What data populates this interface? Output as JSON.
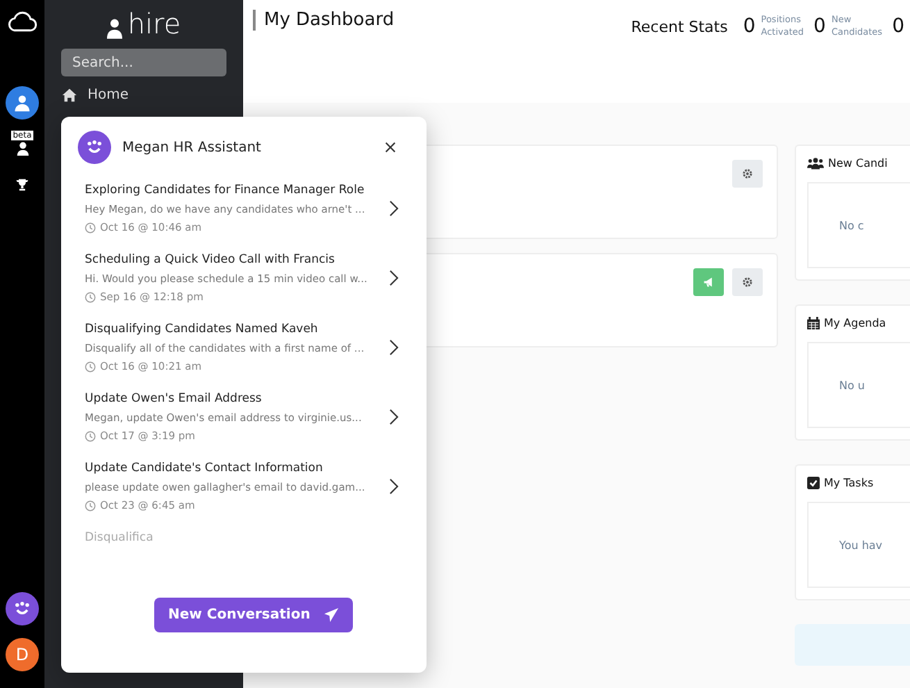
{
  "brand": {
    "name": "hire"
  },
  "sidebar": {
    "search": {
      "placeholder": "Search..."
    },
    "items": [
      {
        "label": "Home",
        "selected": false
      }
    ]
  },
  "rail": {
    "badge": "beta",
    "avatar_letter": "D"
  },
  "header": {
    "title": "My Dashboard",
    "stats_label": "Recent Stats",
    "stats": [
      {
        "value": "0",
        "label_1": "Positions",
        "label_2": "Activated"
      },
      {
        "value": "0",
        "label_1": "New",
        "label_2": "Candidates"
      },
      {
        "value": "0"
      }
    ]
  },
  "positions": [
    {
      "promote": false
    },
    {
      "promote": true
    }
  ],
  "widgets": [
    {
      "kind": "candidates",
      "title": "New Candi",
      "message": "No c"
    },
    {
      "kind": "agenda",
      "title": "My Agenda",
      "message": "No u"
    },
    {
      "kind": "tasks",
      "title": "My Tasks",
      "message": "You hav"
    }
  ],
  "assistant": {
    "title": "Megan HR Assistant",
    "conversations": [
      {
        "title": "Exploring Candidates for Finance Manager Role",
        "preview": "Hey Megan, do we have any candidates who arne't ...",
        "time": "Oct 16 @ 10:46 am"
      },
      {
        "title": "Scheduling a Quick Video Call with Francis",
        "preview": "Hi. Would you please schedule a 15 min video call w...",
        "time": "Sep 16 @ 12:18 pm"
      },
      {
        "title": "Disqualifying Candidates Named Kaveh",
        "preview": "Disqualify all of the candidates with a first name of ...",
        "time": "Oct 16 @ 10:21 am"
      },
      {
        "title": "Update Owen's Email Address",
        "preview": "Megan, update Owen's email address to virginie.us...",
        "time": "Oct 17 @ 3:19 pm"
      },
      {
        "title": "Update Candidate's Contact Information",
        "preview": "please update owen gallagher's email to david.gam...",
        "time": "Oct 23 @ 6:45 am"
      },
      {
        "title": "Disqualifica"
      }
    ],
    "new_button": "New Conversation"
  }
}
